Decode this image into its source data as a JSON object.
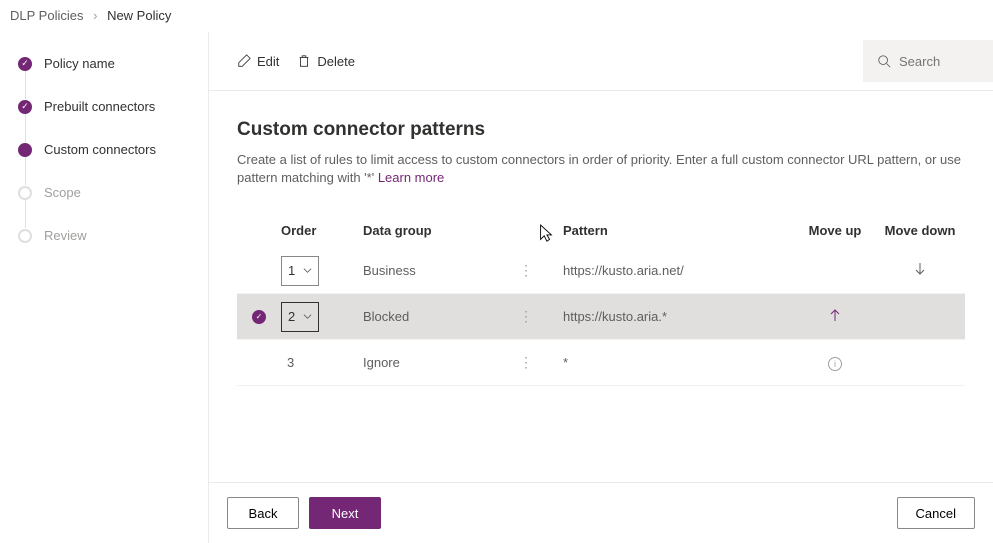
{
  "breadcrumb": {
    "parent": "DLP Policies",
    "current": "New Policy"
  },
  "sidebar": {
    "steps": [
      {
        "label": "Policy name",
        "state": "done"
      },
      {
        "label": "Prebuilt connectors",
        "state": "done"
      },
      {
        "label": "Custom connectors",
        "state": "current"
      },
      {
        "label": "Scope",
        "state": "pending"
      },
      {
        "label": "Review",
        "state": "pending"
      }
    ]
  },
  "toolbar": {
    "edit": "Edit",
    "delete": "Delete"
  },
  "search": {
    "placeholder": "Search"
  },
  "page": {
    "title": "Custom connector patterns",
    "desc_prefix": "Create a list of rules to limit access to custom connectors in order of priority. Enter a full custom connector URL pattern, or use pattern matching with '*' ",
    "desc_link": "Learn more"
  },
  "table": {
    "headers": {
      "order": "Order",
      "group": "Data group",
      "pattern": "Pattern",
      "up": "Move up",
      "down": "Move down"
    },
    "rows": [
      {
        "selected": false,
        "order": "1",
        "editable": true,
        "group": "Business",
        "pattern": "https://kusto.aria.net/",
        "up": false,
        "down": true
      },
      {
        "selected": true,
        "order": "2",
        "editable": true,
        "group": "Blocked",
        "pattern": "https://kusto.aria.*",
        "up": true,
        "down": false
      },
      {
        "selected": false,
        "order": "3",
        "editable": false,
        "group": "Ignore",
        "pattern": "*",
        "up": false,
        "down": false,
        "info": true
      }
    ]
  },
  "footer": {
    "back": "Back",
    "next": "Next",
    "cancel": "Cancel"
  }
}
